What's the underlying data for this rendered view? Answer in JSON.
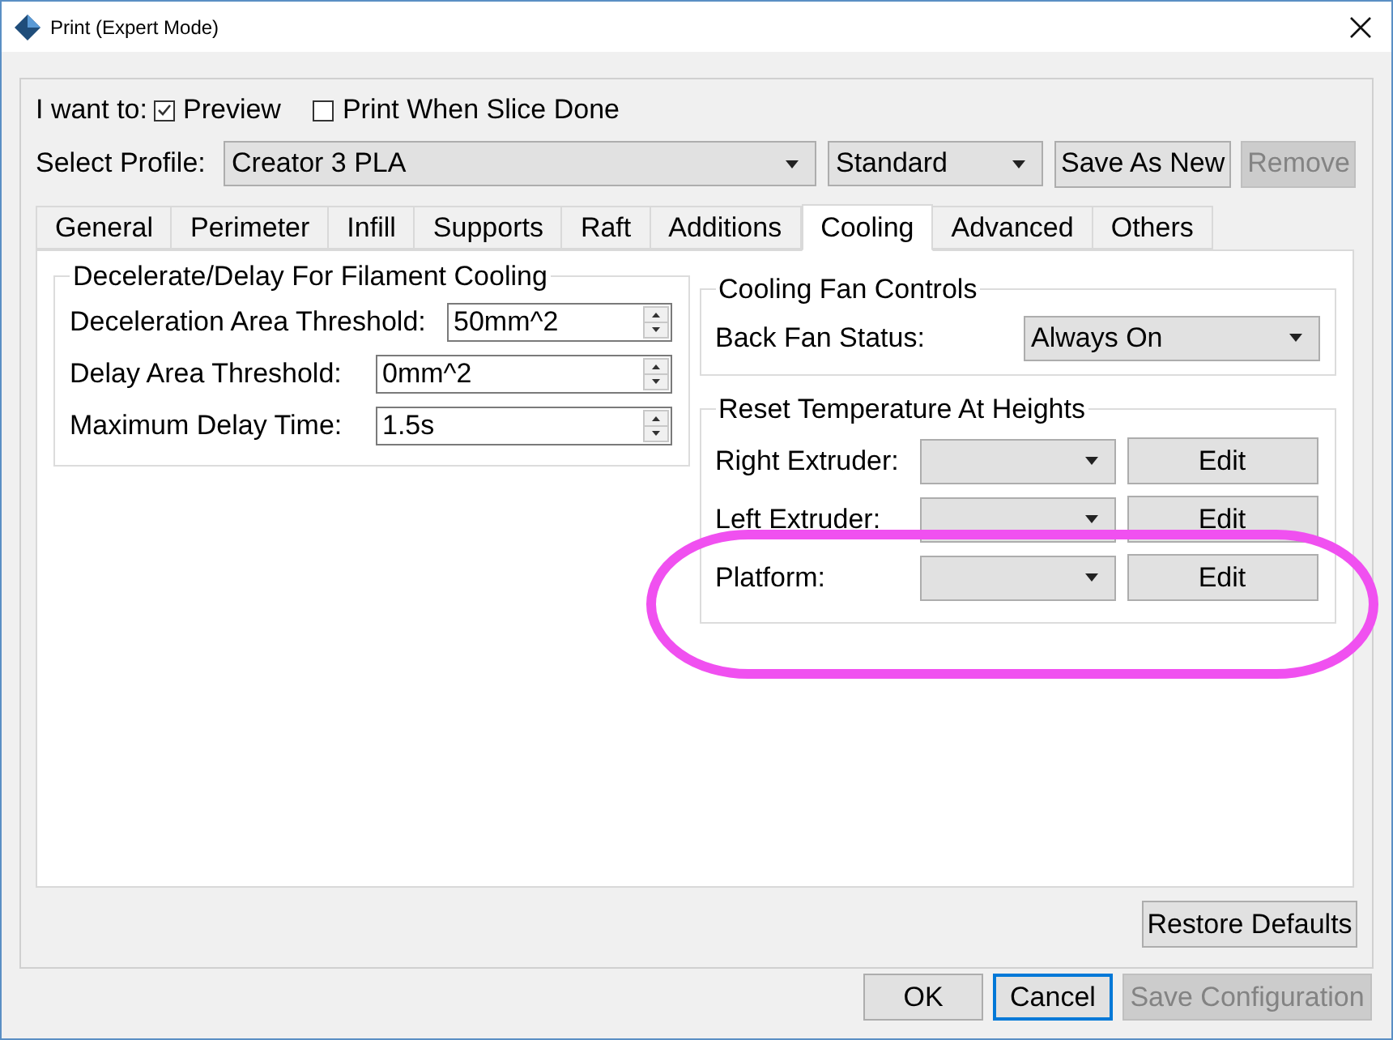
{
  "window": {
    "title": "Print (Expert Mode)"
  },
  "mode": {
    "label": "I want to:",
    "options": [
      {
        "label": "Preview",
        "checked": true
      },
      {
        "label": "Print When Slice Done",
        "checked": false
      }
    ]
  },
  "profile": {
    "label": "Select Profile:",
    "value": "Creator 3 PLA",
    "quality": "Standard",
    "buttons": [
      {
        "label": "Save As New",
        "disabled": false
      },
      {
        "label": "Remove",
        "disabled": true
      }
    ]
  },
  "tabs": [
    {
      "label": "General",
      "selected": false
    },
    {
      "label": "Perimeter",
      "selected": false
    },
    {
      "label": "Infill",
      "selected": false
    },
    {
      "label": "Supports",
      "selected": false
    },
    {
      "label": "Raft",
      "selected": false
    },
    {
      "label": "Additions",
      "selected": false
    },
    {
      "label": "Cooling",
      "selected": true
    },
    {
      "label": "Advanced",
      "selected": false
    },
    {
      "label": "Others",
      "selected": false
    }
  ],
  "filament_cooling": {
    "title": "Decelerate/Delay For Filament Cooling",
    "fields": [
      {
        "label": "Deceleration Area Threshold:",
        "value": "50mm^2"
      },
      {
        "label": "Delay Area Threshold:",
        "value": "0mm^2"
      },
      {
        "label": "Maximum Delay Time:",
        "value": "1.5s"
      }
    ]
  },
  "fan_controls": {
    "title": "Cooling Fan Controls",
    "fields": [
      {
        "label": "Back Fan Status:",
        "value": "Always On"
      }
    ]
  },
  "reset_temperature": {
    "title": "Reset Temperature At Heights",
    "rows": [
      {
        "label": "Right Extruder:",
        "button": "Edit"
      },
      {
        "label": "Left Extruder:",
        "button": "Edit"
      },
      {
        "label": "Platform:",
        "button": "Edit"
      }
    ]
  },
  "annotation": {
    "kind": "ellipse",
    "color": "#f050f0"
  },
  "restore_button": "Restore Defaults",
  "footer_buttons": [
    {
      "label": "OK",
      "focused": false,
      "disabled": false
    },
    {
      "label": "Cancel",
      "focused": true,
      "disabled": false
    },
    {
      "label": "Save Configuration",
      "focused": false,
      "disabled": true
    }
  ]
}
